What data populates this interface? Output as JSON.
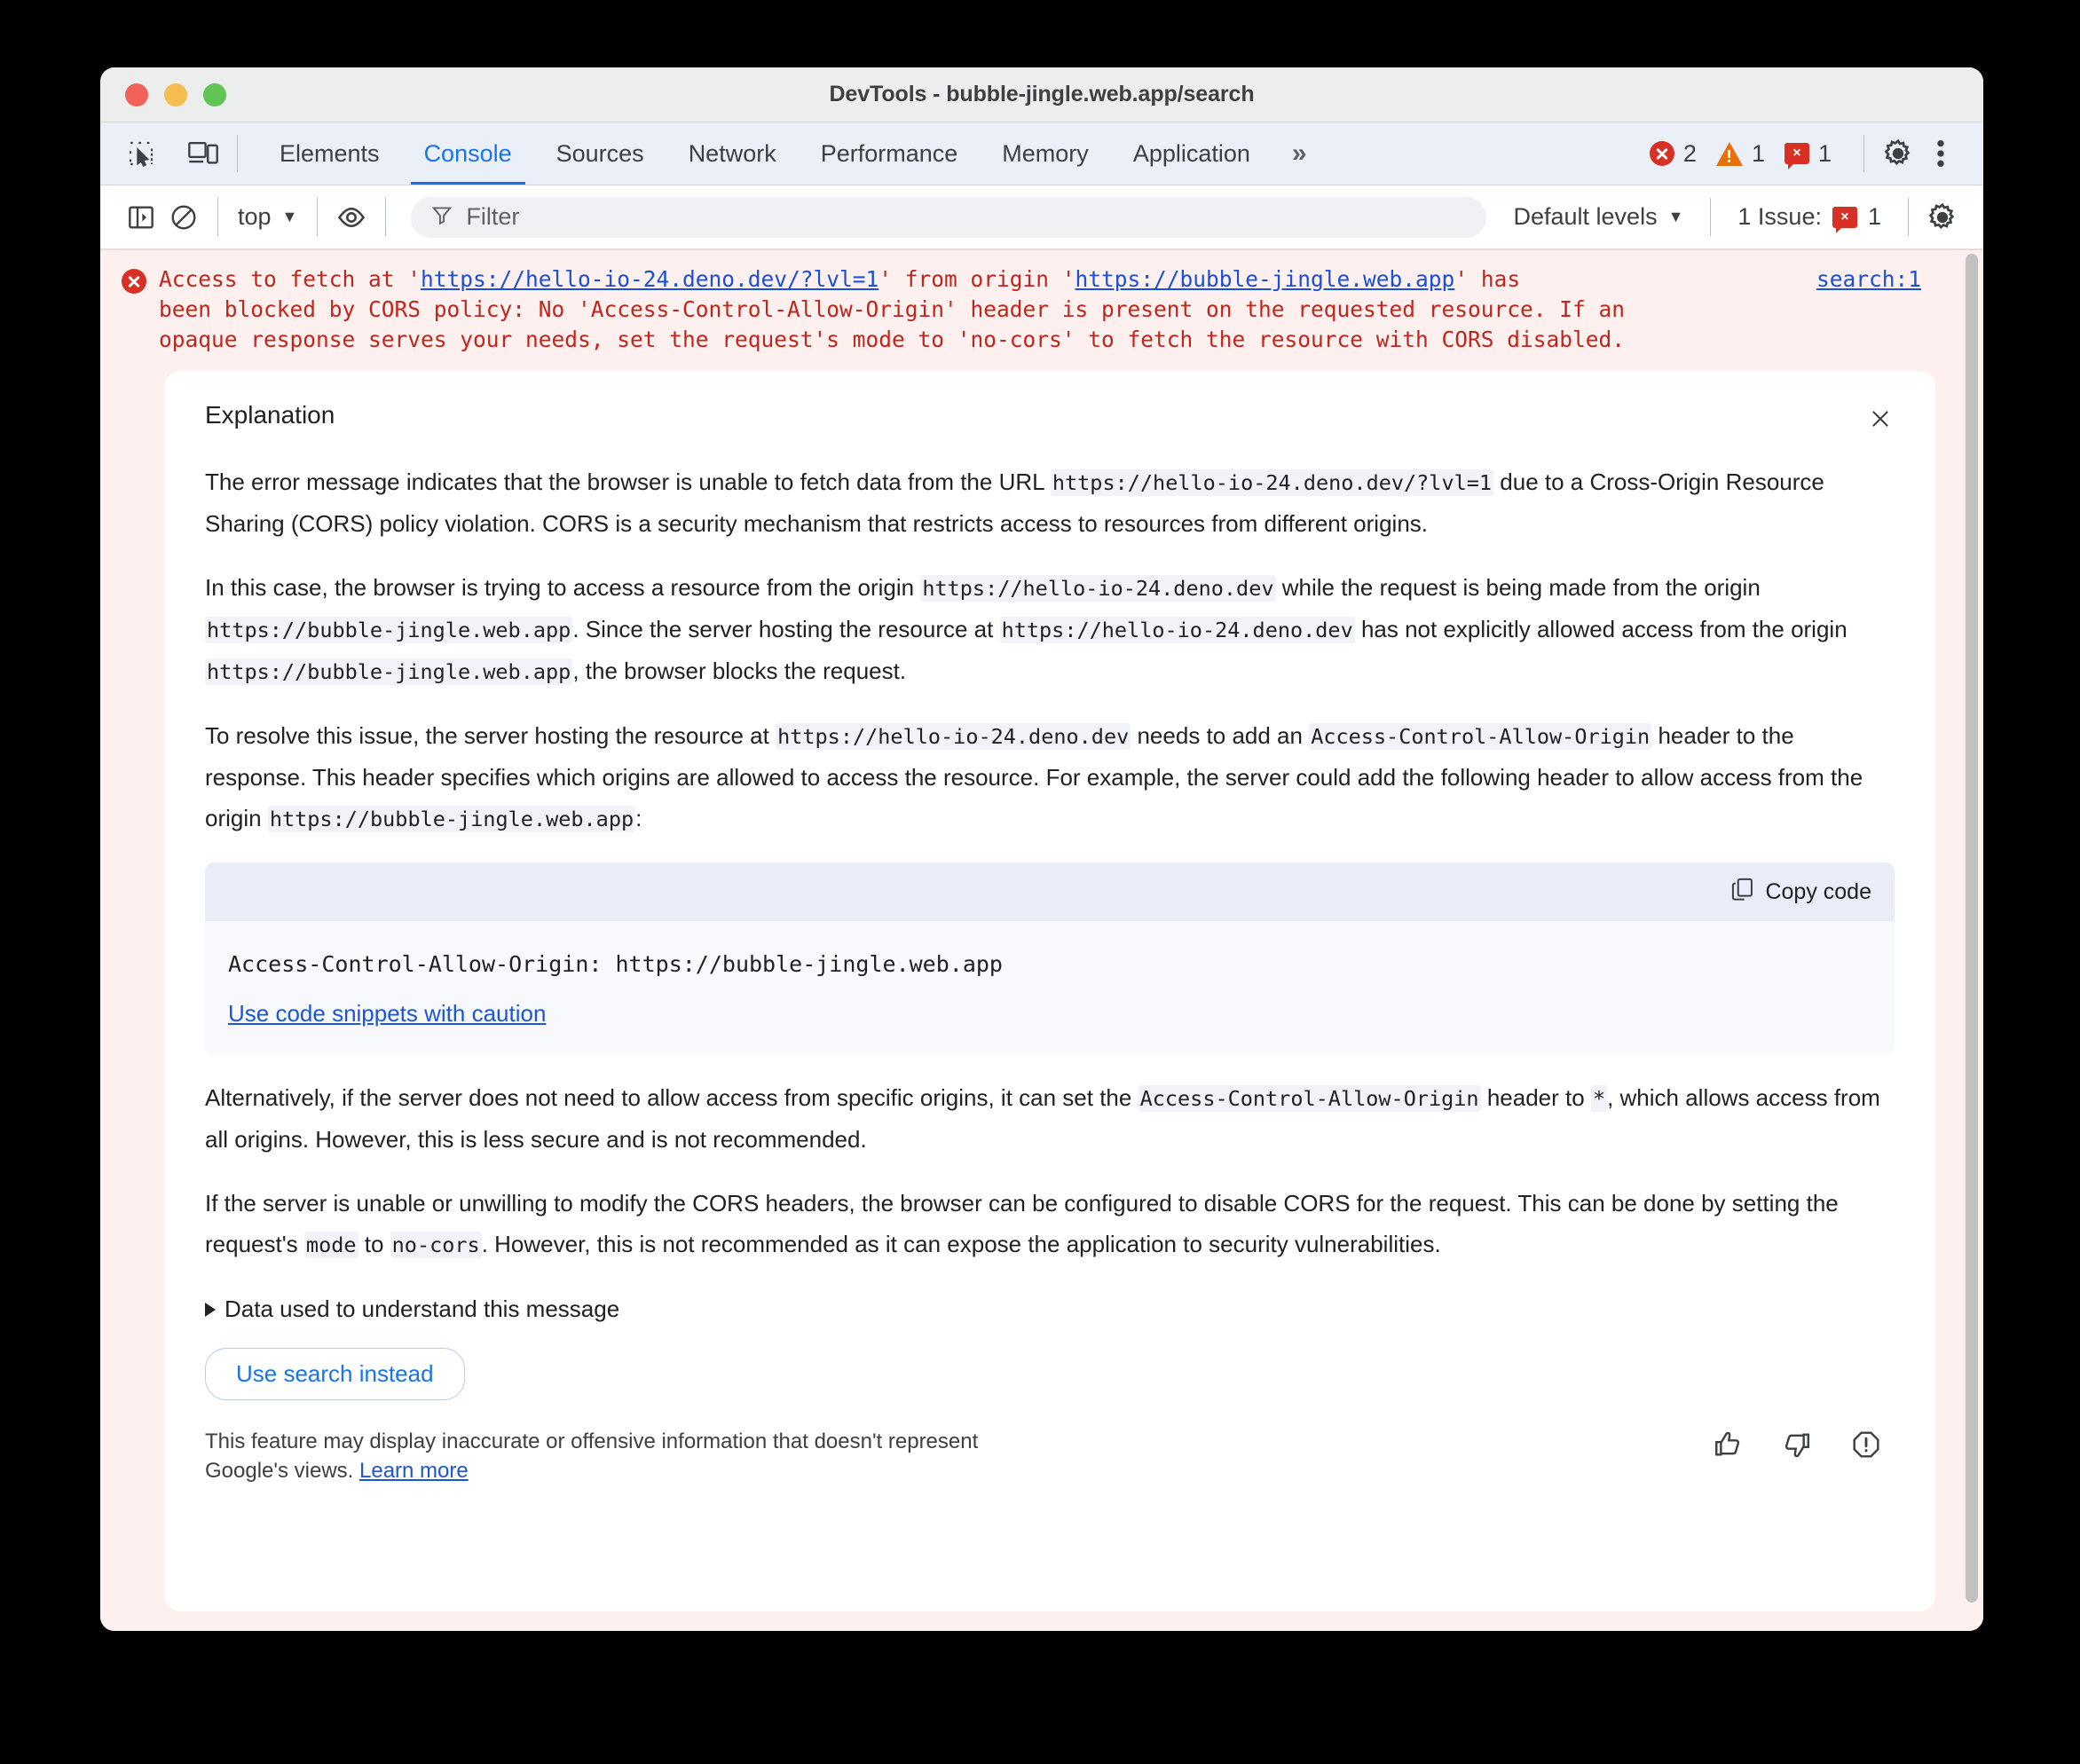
{
  "window": {
    "title": "DevTools - bubble-jingle.web.app/search",
    "traffic_lights": [
      "close",
      "minimize",
      "zoom"
    ]
  },
  "tabstrip": {
    "left_icons": [
      "inspect-element-icon",
      "device-toolbar-icon"
    ],
    "tabs": [
      {
        "label": "Elements",
        "active": false
      },
      {
        "label": "Console",
        "active": true
      },
      {
        "label": "Sources",
        "active": false
      },
      {
        "label": "Network",
        "active": false
      },
      {
        "label": "Performance",
        "active": false
      },
      {
        "label": "Memory",
        "active": false
      },
      {
        "label": "Application",
        "active": false
      }
    ],
    "overflow_label": "»",
    "counters": [
      {
        "icon": "error-icon",
        "count": "2"
      },
      {
        "icon": "warning-icon",
        "count": "1"
      },
      {
        "icon": "issue-icon",
        "count": "1"
      }
    ],
    "settings_icon": "gear-icon",
    "more_icon": "kebab-menu-icon"
  },
  "console_toolbar": {
    "sidebar_icon": "console-sidebar-icon",
    "clear_icon": "clear-console-icon",
    "context": "top",
    "eye_icon": "live-expression-icon",
    "filter_placeholder": "Filter",
    "filter_value": "",
    "filter_icon": "filter-funnel-icon",
    "levels_label": "Default levels",
    "issues_label": "1 Issue:",
    "issues_count": "1",
    "settings_icon": "gear-icon"
  },
  "console_message": {
    "icon": "error-icon",
    "line1_pre": "Access to fetch at '",
    "link1": "https://hello-io-24.deno.dev/?lvl=1",
    "line1_mid": "' from origin '",
    "link2": "https://bubble-jingle.web.app",
    "line1_post": "' has",
    "line2": "been blocked by CORS policy: No 'Access-Control-Allow-Origin' header is present on the requested resource. If an",
    "line3": "opaque response serves your needs, set the request's mode to 'no-cors' to fetch the resource with CORS disabled.",
    "source_link": "search:1"
  },
  "explanation": {
    "title": "Explanation",
    "close_icon": "close-icon",
    "paragraph1": {
      "t1": "The error message indicates that the browser is unable to fetch data from the URL ",
      "c1": "https://hello-io-24.deno.dev/?lvl=1",
      "t2": " due to a Cross-Origin Resource Sharing (CORS) policy violation. CORS is a security mechanism that restricts access to resources from different origins."
    },
    "paragraph2": {
      "t1": "In this case, the browser is trying to access a resource from the origin ",
      "c1": "https://hello-io-24.deno.dev",
      "t2": " while the request is being made from the origin ",
      "c2": "https://bubble-jingle.web.app",
      "t3": ". Since the server hosting the resource at ",
      "c3": "https://hello-io-24.deno.dev",
      "t4": " has not explicitly allowed access from the origin ",
      "c4": "https://bubble-jingle.web.app",
      "t5": ", the browser blocks the request."
    },
    "paragraph3": {
      "t1": "To resolve this issue, the server hosting the resource at ",
      "c1": "https://hello-io-24.deno.dev",
      "t2": " needs to add an ",
      "c2": "Access-Control-Allow-Origin",
      "t3": " header to the response. This header specifies which origins are allowed to access the resource. For example, the server could add the following header to allow access from the origin ",
      "c3": "https://bubble-jingle.web.app",
      "t4": ":"
    },
    "codeblock": {
      "copy_label": "Copy code",
      "copy_icon": "copy-icon",
      "code": "Access-Control-Allow-Origin: https://bubble-jingle.web.app",
      "caution_link": "Use code snippets with caution"
    },
    "paragraph4": {
      "t1": "Alternatively, if the server does not need to allow access from specific origins, it can set the ",
      "c1": "Access-Control-Allow-Origin",
      "t2": " header to ",
      "c2": "*",
      "t3": ", which allows access from all origins. However, this is less secure and is not recommended."
    },
    "paragraph5": {
      "t1": "If the server is unable or unwilling to modify the CORS headers, the browser can be configured to disable CORS for the request. This can be done by setting the request's ",
      "c1": "mode",
      "t2": " to ",
      "c2": "no-cors",
      "t3": ". However, this is not recommended as it can expose the application to security vulnerabilities."
    },
    "disclosure_label": "Data used to understand this message",
    "search_button": "Use search instead",
    "disclaimer_text": "This feature may display inaccurate or offensive information that doesn't represent Google's views. ",
    "disclaimer_link": "Learn more",
    "feedback_icons": [
      "thumb-up-icon",
      "thumb-down-icon",
      "report-icon"
    ]
  },
  "colors": {
    "accent": "#1a73e8",
    "error": "#d93025",
    "warning": "#e8710a",
    "error_bg": "#fdf0ef",
    "code_bg": "#f1f3f9"
  }
}
